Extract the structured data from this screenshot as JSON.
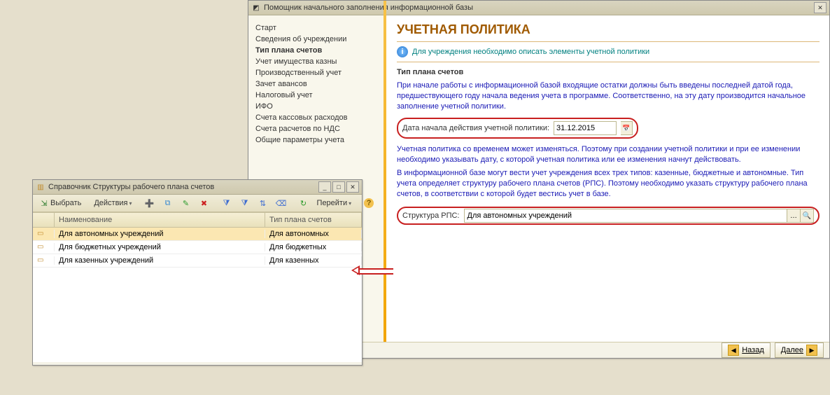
{
  "wizard": {
    "title": "Помощник начального заполнения информационной базы",
    "nav_items": [
      "Старт",
      "Сведения об учреждении",
      "Тип плана счетов",
      "Учет имущества казны",
      "Производственный учет",
      "Зачет авансов",
      "Налоговый учет",
      "ИФО",
      "Счета кассовых расходов",
      "Счета расчетов по НДС",
      "Общие параметры учета"
    ],
    "nav_active_index": 2,
    "page_heading": "УЧЕТНАЯ ПОЛИТИКА",
    "hint": "Для учреждения необходимо описать элементы учетной политики",
    "section_heading": "Тип плана счетов",
    "para1": "При начале работы с информационной базой входящие остатки должны быть введены последней датой года, предшествующего году начала ведения учета в программе. Соответственно, на эту дату производится начальное заполнение учетной политики.",
    "date_label": "Дата начала действия учетной политики:",
    "date_value": "31.12.2015",
    "para2": "Учетная политика со временем может изменяться. Поэтому при создании учетной политики и при ее изменении необходимо указывать дату, с которой учетная политика или ее изменения начнут действовать.",
    "para3": "В информационной базе могут вести учет учреждения всех трех типов: казенные, бюджетные и автономные. Тип учета определяет структуру рабочего плана счетов (РПС). Поэтому необходимо указать структуру рабочего плана счетов, в соответствии с которой будет вестись учет в базе.",
    "rps_label": "Структура РПС:",
    "rps_value": "Для автономных учреждений",
    "back_label": "Назад",
    "next_label": "Далее"
  },
  "reference": {
    "title": "Справочник Структуры рабочего плана счетов",
    "btn_select": "Выбрать",
    "btn_actions": "Действия",
    "btn_goto": "Перейти",
    "cols": {
      "name": "Наименование",
      "type": "Тип плана счетов"
    },
    "rows": [
      {
        "name": "Для автономных учреждений",
        "type": "Для автономных"
      },
      {
        "name": "Для бюджетных учреждений",
        "type": "Для бюджетных"
      },
      {
        "name": "Для казенных учреждений",
        "type": "Для казенных"
      }
    ],
    "selected_index": 0
  }
}
